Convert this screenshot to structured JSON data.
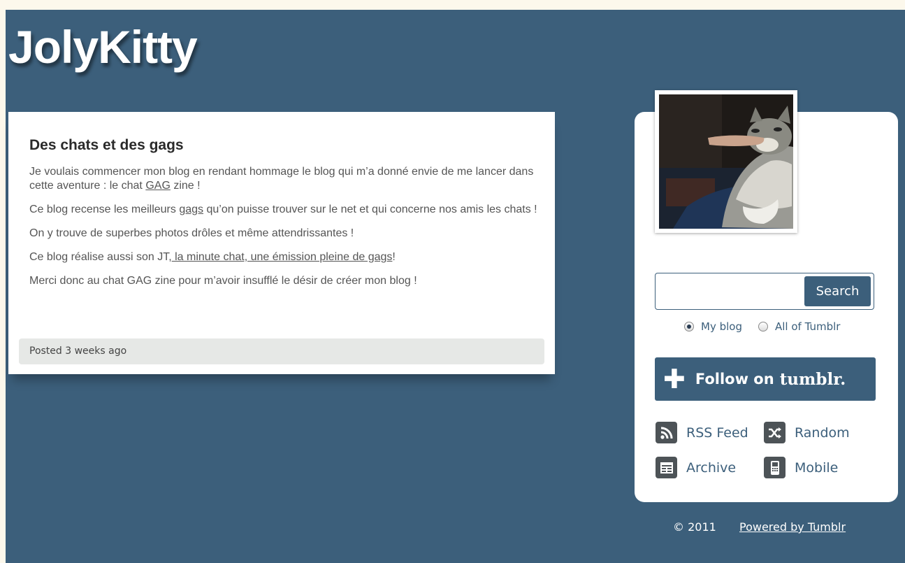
{
  "blog": {
    "title": "JolyKitty"
  },
  "post": {
    "title": "Des chats et des gags",
    "paragraphs": [
      {
        "before": "Je voulais commencer mon blog en rendant hommage le blog qui m’a donné envie de me lancer dans cette aventure : le chat ",
        "link": "GAG",
        "after": " zine !"
      },
      {
        "before": "Ce blog recense les meilleurs ",
        "link": "gags",
        "after": " qu’on puisse trouver sur le net et qui concerne nos amis les chats !"
      },
      {
        "text": "On y trouve de superbes photos drôles et même attendrissantes !"
      },
      {
        "before": "Ce blog réalise aussi son JT,",
        "link": " la minute chat, une émission pleine de gags",
        "after": "!"
      },
      {
        "text": "Merci donc au chat GAG zine pour m’avoir insufflé le désir de créer mon blog !"
      }
    ],
    "footer": "Posted 3 weeks ago"
  },
  "sidebar": {
    "search": {
      "input_value": "",
      "button_label": "Search"
    },
    "scope": {
      "my_blog": "My blog",
      "all": "All of Tumblr",
      "selected": "my_blog"
    },
    "follow": {
      "label": "Follow on",
      "brand": "tumblr."
    },
    "links": {
      "rss": "RSS Feed",
      "random": "Random",
      "archive": "Archive",
      "mobile": "Mobile"
    }
  },
  "footer": {
    "copyright": "© 2011",
    "powered": "Powered by Tumblr"
  },
  "colors": {
    "background": "#3c5f7b",
    "page_strip": "#fcf8ec",
    "icon_tile": "#4d5357"
  },
  "icons": [
    "rss-icon",
    "shuffle-icon",
    "archive-icon",
    "mobile-icon",
    "plus-icon"
  ]
}
